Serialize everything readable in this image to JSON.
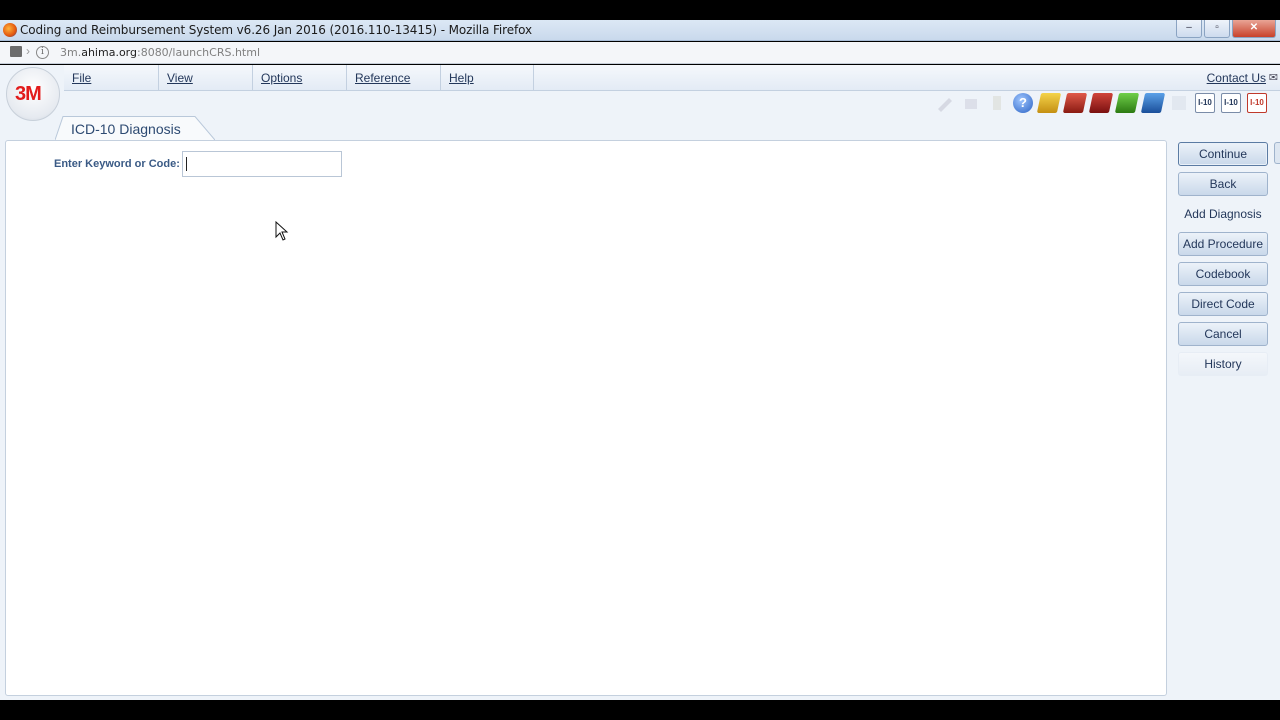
{
  "browser": {
    "title": "Coding and Reimbursement System v6.26 Jan 2016 (2016.110-13415) - Mozilla Firefox",
    "url_host": "3m.",
    "url_domain": "ahima.org",
    "url_rest": ":8080/launchCRS.html",
    "win_minimize": "‒",
    "win_maximize": "▫",
    "win_close": "✕"
  },
  "app": {
    "logo_text": "3M",
    "menu": {
      "file": "File",
      "view": "View",
      "options": "Options",
      "reference": "Reference",
      "help": "Help"
    },
    "contact": "Contact Us",
    "toolbar": {
      "help_glyph": "?",
      "icd10_a": "I-10",
      "icd10_b": "I-10",
      "icd10_c": "I-10"
    },
    "tab_title": "ICD-10 Diagnosis",
    "form": {
      "keyword_label": "Enter Keyword or Code:",
      "keyword_value": ""
    },
    "sidebar": {
      "continue": "Continue",
      "back": "Back",
      "add_diagnosis": "Add Diagnosis",
      "add_procedure": "Add Procedure",
      "codebook": "Codebook",
      "direct_code": "Direct Code",
      "cancel": "Cancel",
      "history": "History"
    }
  }
}
